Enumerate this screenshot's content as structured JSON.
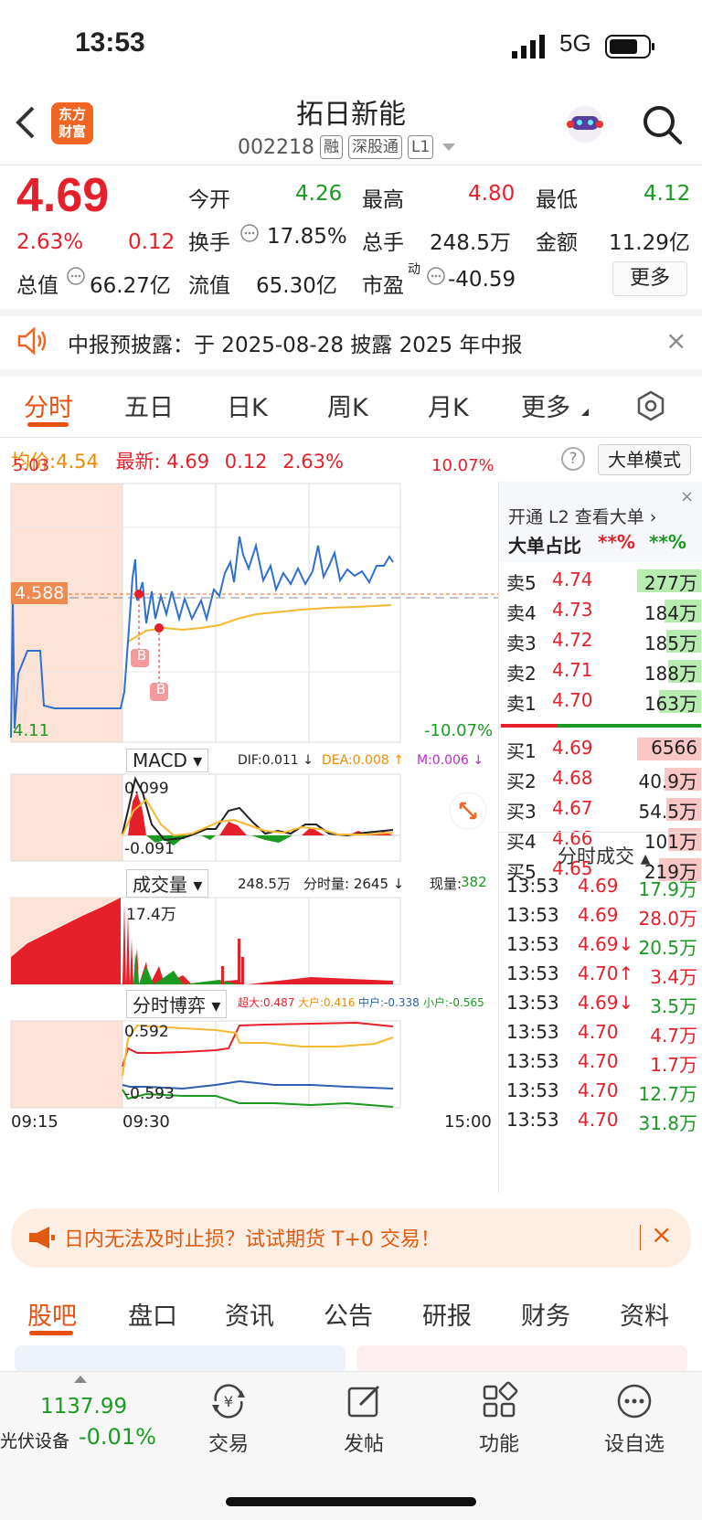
{
  "status_bar": {
    "time": "13:53",
    "network": "5G"
  },
  "header": {
    "name": "拓日新能",
    "code": "002218",
    "tags": [
      "融",
      "深股通",
      "L1"
    ],
    "logo": "东方\n财富"
  },
  "quote": {
    "price": "4.69",
    "pct": "2.63%",
    "change": "0.12",
    "open_label": "今开",
    "open": "4.26",
    "high_label": "最高",
    "high": "4.80",
    "low_label": "最低",
    "low": "4.12",
    "turnover_label": "换手",
    "turnover": "17.85%",
    "volume_label": "总手",
    "volume": "248.5万",
    "amount_label": "金额",
    "amount": "11.29亿",
    "mcap_label": "总值",
    "mcap": "66.27亿",
    "float_label": "流值",
    "float": "65.30亿",
    "pe_label": "市盈",
    "pe_sup": "动",
    "pe": "-40.59",
    "more": "更多"
  },
  "notice": {
    "text": "中报预披露：于 2025-08-28 披露 2025 年中报"
  },
  "tabs": [
    "分时",
    "五日",
    "日K",
    "周K",
    "月K",
    "更多"
  ],
  "info": {
    "avg_label": "均价:",
    "avg": "4.54",
    "latest_label": "最新:",
    "latest": "4.69",
    "chg": "0.12",
    "pct": "2.63%",
    "mode_btn": "大单模式"
  },
  "chart": {
    "top_price": "5.03",
    "top_pct": "10.07%",
    "bottom_price": "4.11",
    "bottom_pct": "-10.07%",
    "mark_price": "4.588",
    "macd_title": "MACD",
    "dif": "DIF:0.011 ↓",
    "dea": "DEA:0.008 ↑",
    "m": "M:0.006 ↓",
    "macd_top": "0.099",
    "macd_bottom": "-0.091",
    "vol_title": "成交量",
    "vol_total": "248.5万",
    "vol_min": "分时量: 2645 ↓",
    "vol_now_label": "现量:",
    "vol_now": "382",
    "vol_max": "17.4万",
    "game_title": "分时博弈",
    "super": "超大:0.487",
    "big": "大户:0.416",
    "mid": "中户:-0.338",
    "small": "小户:-0.565",
    "game_top": "0.592",
    "game_bottom": "-0.593",
    "time_start": "09:15",
    "time_open": "09:30",
    "time_end": "15:00",
    "b_label": "B"
  },
  "orderbook": {
    "l2_link": "开通 L2 查看大单 ›",
    "ratio_label": "大单占比",
    "ratio_sell": "**%",
    "ratio_buy": "**%",
    "asks": [
      {
        "l": "卖5",
        "p": "4.74",
        "v": "277万"
      },
      {
        "l": "卖4",
        "p": "4.73",
        "v": "184万"
      },
      {
        "l": "卖3",
        "p": "4.72",
        "v": "185万"
      },
      {
        "l": "卖2",
        "p": "4.71",
        "v": "188万"
      },
      {
        "l": "卖1",
        "p": "4.70",
        "v": "163万"
      }
    ],
    "bids": [
      {
        "l": "买1",
        "p": "4.69",
        "v": "6566"
      },
      {
        "l": "买2",
        "p": "4.68",
        "v": "40.9万"
      },
      {
        "l": "买3",
        "p": "4.67",
        "v": "54.5万"
      },
      {
        "l": "买4",
        "p": "4.66",
        "v": "101万"
      },
      {
        "l": "买5",
        "p": "4.65",
        "v": "219万"
      }
    ],
    "trades_title": "分时成交",
    "trades": [
      {
        "t": "13:53",
        "p": "4.69",
        "v": "17.9万",
        "pc": "red",
        "vc": "green"
      },
      {
        "t": "13:53",
        "p": "4.69",
        "v": "28.0万",
        "pc": "red",
        "vc": "red"
      },
      {
        "t": "13:53",
        "p": "4.69↓",
        "v": "20.5万",
        "pc": "red",
        "vc": "green"
      },
      {
        "t": "13:53",
        "p": "4.70↑",
        "v": "3.4万",
        "pc": "red",
        "vc": "red"
      },
      {
        "t": "13:53",
        "p": "4.69↓",
        "v": "3.5万",
        "pc": "red",
        "vc": "green"
      },
      {
        "t": "13:53",
        "p": "4.70",
        "v": "4.7万",
        "pc": "red",
        "vc": "red"
      },
      {
        "t": "13:53",
        "p": "4.70",
        "v": "1.7万",
        "pc": "red",
        "vc": "red"
      },
      {
        "t": "13:53",
        "p": "4.70",
        "v": "12.7万",
        "pc": "red",
        "vc": "green"
      },
      {
        "t": "13:53",
        "p": "4.70",
        "v": "31.8万",
        "pc": "red",
        "vc": "green"
      }
    ]
  },
  "ad": {
    "text": "日内无法及时止损？试试期货 T+0 交易！"
  },
  "bottom_tabs": [
    "股吧",
    "盘口",
    "资讯",
    "公告",
    "研报",
    "财务",
    "资料"
  ],
  "bottom_nav": {
    "index_value": "1137.99",
    "index_name": "光伏设备",
    "index_pct": "-0.01%",
    "trade": "交易",
    "post": "发帖",
    "func": "功能",
    "watch": "设自选"
  }
}
